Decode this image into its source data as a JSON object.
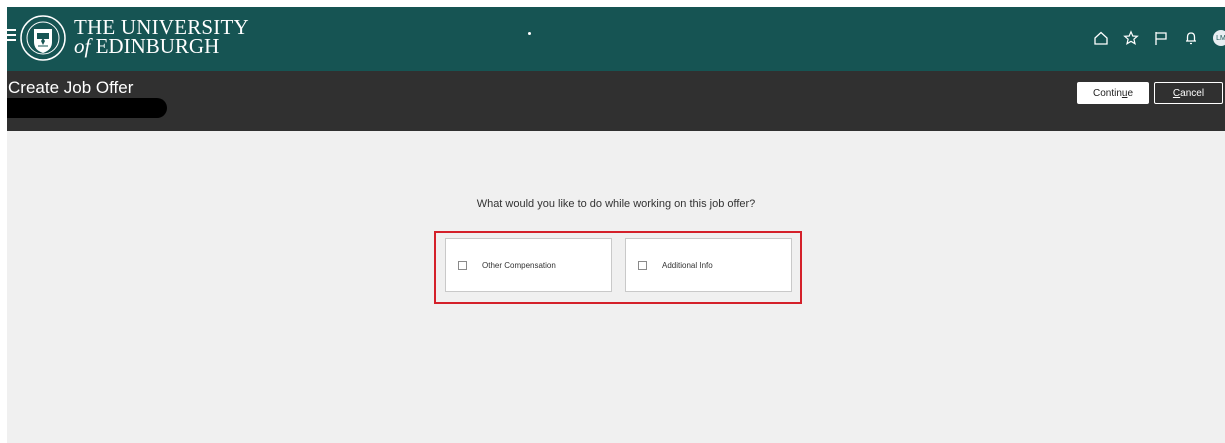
{
  "header": {
    "university_line1": "THE UNIVERSITY",
    "university_line2_prefix": "of",
    "university_line2": "EDINBURGH",
    "background": "#165453",
    "icons": [
      "menu-icon",
      "home-icon",
      "star-icon",
      "flag-icon",
      "bell-icon"
    ],
    "avatar_initials": "LM"
  },
  "titlebar": {
    "title": "Create Job Offer",
    "continue_label_pre": "Contin",
    "continue_label_ul": "u",
    "continue_label_post": "e",
    "cancel_label_ul": "C",
    "cancel_label_post": "ancel"
  },
  "main": {
    "question": "What would you like to do while working on this job offer?",
    "options": [
      {
        "label": "Other Compensation",
        "checked": false
      },
      {
        "label": "Additional Info",
        "checked": false
      }
    ],
    "highlight_color": "#d4202a"
  }
}
